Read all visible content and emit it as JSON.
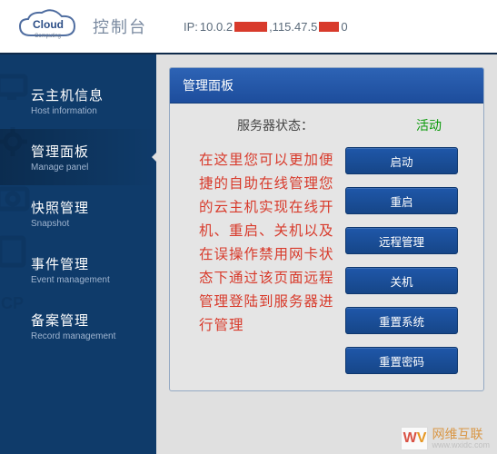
{
  "header": {
    "brand_top": "Cloud",
    "brand_sub": "Computing",
    "title": "控制台",
    "ip_label": "IP:",
    "ip_part1": "10.0.2",
    "ip_part2": ",115.47.5",
    "ip_part3": "0"
  },
  "sidebar": {
    "items": [
      {
        "cn": "云主机信息",
        "en": "Host information"
      },
      {
        "cn": "管理面板",
        "en": "Manage panel"
      },
      {
        "cn": "快照管理",
        "en": "Snapshot"
      },
      {
        "cn": "事件管理",
        "en": "Event management"
      },
      {
        "cn": "备案管理",
        "en": "Record management"
      }
    ],
    "active_index": 1
  },
  "panel": {
    "title": "管理面板",
    "status_label": "服务器状态：",
    "status_value": "活动",
    "description": "在这里您可以更加便捷的自助在线管理您的云主机实现在线开机、重启、关机以及在误操作禁用网卡状态下通过该页面远程管理登陆到服务器进行管理",
    "buttons": [
      "启动",
      "重启",
      "远程管理",
      "关机",
      "重置系统",
      "重置密码"
    ]
  },
  "watermark": {
    "badge1": "W",
    "badge2": "V",
    "line1": "网维互联",
    "line2": "www.wxidc.com"
  },
  "colors": {
    "accent": "#1f57a9",
    "danger": "#d83a2b",
    "ok": "#0a9a0a",
    "sidebar_bg": "#0f3b6a"
  }
}
